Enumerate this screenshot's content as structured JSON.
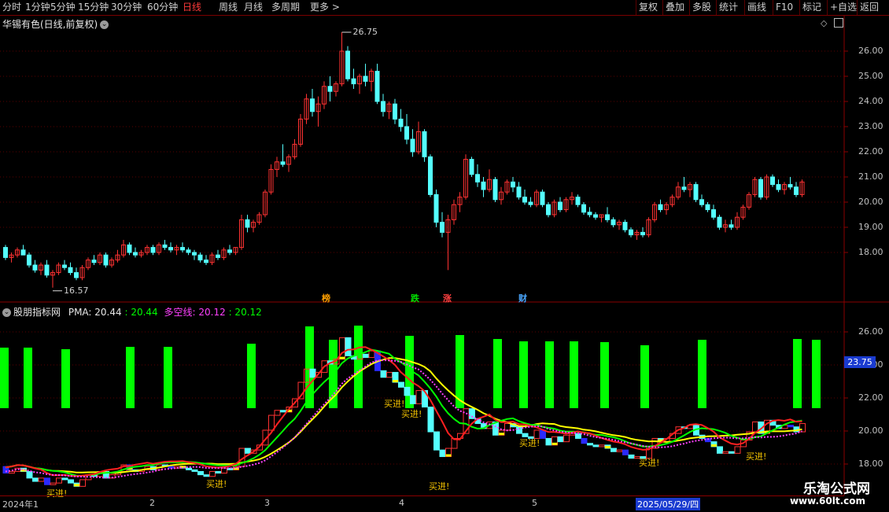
{
  "toolbar": {
    "left": [
      "分时",
      "1分钟",
      "5分钟",
      "15分钟",
      "30分钟",
      "60分钟",
      "日线",
      "周线",
      "月线",
      "多周期",
      "更多 >"
    ],
    "active": "日线",
    "right": [
      "复权",
      "叠加",
      "多股",
      "统计",
      "画线",
      "F10",
      "标记",
      "+自选",
      "返回"
    ]
  },
  "main": {
    "title": "华锡有色(日线,前复权)",
    "y_ticks": [
      "26.00",
      "25.00",
      "24.00",
      "23.00",
      "22.00",
      "21.00",
      "20.00",
      "19.00",
      "18.00"
    ],
    "high_label": "26.75",
    "low_label": "16.57",
    "events": [
      {
        "text": "榜",
        "color": "#ffa000"
      },
      {
        "text": "跌",
        "color": "#00e000"
      },
      {
        "text": "涨",
        "color": "#ff4040"
      },
      {
        "text": "财",
        "color": "#4aa8ff"
      }
    ]
  },
  "indicator": {
    "name": "股朋指标网",
    "pma_label": "PMA: 20.44",
    "pma_value": ": 20.44",
    "dk_label": "多空线: 20.12",
    "dk_value": ": 20.12",
    "y_ticks": [
      "26.00",
      "24.00",
      "22.00",
      "20.00",
      "18.00"
    ],
    "marker": "23.75",
    "notes": [
      "买进!",
      "买进!",
      "买进!",
      "买进!",
      "买进!",
      "买进!",
      "买进!",
      "买进!"
    ]
  },
  "dates": [
    "2024年1",
    "2",
    "3",
    "4",
    "5",
    "2025/05/29/四"
  ],
  "watermark": {
    "line1": "乐淘公式网",
    "line2": "www.60lt.com"
  },
  "colors": {
    "up": "#ff3232",
    "down": "#54ffff",
    "bg": "#000000",
    "grid": "#8a0000",
    "green": "#00ff00",
    "yellow": "#ffff00",
    "magenta": "#ff40ff"
  },
  "chart_data": {
    "type": "candlestick",
    "ylim": [
      17.0,
      27.0
    ],
    "high_marker": 26.75,
    "low_marker": 16.57,
    "ohlc": [
      [
        18.2,
        18.3,
        17.7,
        17.8
      ],
      [
        17.8,
        18.0,
        17.6,
        17.9
      ],
      [
        17.9,
        18.2,
        17.8,
        18.1
      ],
      [
        18.1,
        18.3,
        17.9,
        17.9
      ],
      [
        17.9,
        18.0,
        17.4,
        17.5
      ],
      [
        17.5,
        17.7,
        17.2,
        17.3
      ],
      [
        17.3,
        17.6,
        17.1,
        17.5
      ],
      [
        17.5,
        17.7,
        17.0,
        17.1
      ],
      [
        17.1,
        17.3,
        16.6,
        17.2
      ],
      [
        17.2,
        17.6,
        17.1,
        17.5
      ],
      [
        17.5,
        17.7,
        17.3,
        17.4
      ],
      [
        17.4,
        17.6,
        17.1,
        17.2
      ],
      [
        17.2,
        17.4,
        16.9,
        17.0
      ],
      [
        17.0,
        17.5,
        16.9,
        17.4
      ],
      [
        17.4,
        17.8,
        17.3,
        17.7
      ],
      [
        17.7,
        17.9,
        17.5,
        17.6
      ],
      [
        17.6,
        18.0,
        17.5,
        17.9
      ],
      [
        17.9,
        18.0,
        17.4,
        17.5
      ],
      [
        17.5,
        17.8,
        17.4,
        17.7
      ],
      [
        17.7,
        18.1,
        17.6,
        17.9
      ],
      [
        17.9,
        18.5,
        17.8,
        18.3
      ],
      [
        18.3,
        18.4,
        17.9,
        18.0
      ],
      [
        18.0,
        18.2,
        17.8,
        17.9
      ],
      [
        17.9,
        18.1,
        17.8,
        18.0
      ],
      [
        18.0,
        18.3,
        17.9,
        18.2
      ],
      [
        18.2,
        18.3,
        17.9,
        18.0
      ],
      [
        18.0,
        18.4,
        17.9,
        18.3
      ],
      [
        18.3,
        18.5,
        18.1,
        18.2
      ],
      [
        18.2,
        18.4,
        18.0,
        18.1
      ],
      [
        18.1,
        18.3,
        17.9,
        18.2
      ],
      [
        18.2,
        18.4,
        18.0,
        18.1
      ],
      [
        18.1,
        18.2,
        17.9,
        18.0
      ],
      [
        18.0,
        18.1,
        17.7,
        17.9
      ],
      [
        17.9,
        18.0,
        17.6,
        17.7
      ],
      [
        17.7,
        17.9,
        17.5,
        17.6
      ],
      [
        17.6,
        18.0,
        17.5,
        17.9
      ],
      [
        17.9,
        18.1,
        17.7,
        17.8
      ],
      [
        17.8,
        18.2,
        17.7,
        18.1
      ],
      [
        18.1,
        18.3,
        17.9,
        18.0
      ],
      [
        18.0,
        18.2,
        17.9,
        18.2
      ],
      [
        18.2,
        19.5,
        18.1,
        19.3
      ],
      [
        19.3,
        19.5,
        18.8,
        19.0
      ],
      [
        19.0,
        19.3,
        18.8,
        19.2
      ],
      [
        19.2,
        19.6,
        19.1,
        19.5
      ],
      [
        19.5,
        20.5,
        19.4,
        20.4
      ],
      [
        20.4,
        21.5,
        20.3,
        21.3
      ],
      [
        21.3,
        21.8,
        21.0,
        21.6
      ],
      [
        21.6,
        22.3,
        21.4,
        21.5
      ],
      [
        21.5,
        21.9,
        21.2,
        21.8
      ],
      [
        21.8,
        22.5,
        21.7,
        22.3
      ],
      [
        22.3,
        23.5,
        22.2,
        23.3
      ],
      [
        23.3,
        24.3,
        23.1,
        24.1
      ],
      [
        24.1,
        24.5,
        23.4,
        23.6
      ],
      [
        23.6,
        24.2,
        23.0,
        23.9
      ],
      [
        23.9,
        24.8,
        23.7,
        24.6
      ],
      [
        24.6,
        25.0,
        24.0,
        24.4
      ],
      [
        24.4,
        24.8,
        24.2,
        24.7
      ],
      [
        24.7,
        26.75,
        24.6,
        26.0
      ],
      [
        26.0,
        26.2,
        24.8,
        24.9
      ],
      [
        24.9,
        25.3,
        24.5,
        24.7
      ],
      [
        24.7,
        25.1,
        24.3,
        25.0
      ],
      [
        25.0,
        25.5,
        24.6,
        24.8
      ],
      [
        24.8,
        25.3,
        24.4,
        25.2
      ],
      [
        25.2,
        25.5,
        23.9,
        24.0
      ],
      [
        24.0,
        24.3,
        23.4,
        23.6
      ],
      [
        23.6,
        24.0,
        23.3,
        23.9
      ],
      [
        23.9,
        24.1,
        23.1,
        23.3
      ],
      [
        23.3,
        23.7,
        22.8,
        23.0
      ],
      [
        23.0,
        23.5,
        22.3,
        22.5
      ],
      [
        22.5,
        22.9,
        21.8,
        22.0
      ],
      [
        22.0,
        23.2,
        21.9,
        22.8
      ],
      [
        22.8,
        22.9,
        21.6,
        21.8
      ],
      [
        21.8,
        21.9,
        20.2,
        20.3
      ],
      [
        20.3,
        20.5,
        19.0,
        19.2
      ],
      [
        19.2,
        19.6,
        18.6,
        18.8
      ],
      [
        18.8,
        19.5,
        17.3,
        19.3
      ],
      [
        19.3,
        20.1,
        19.1,
        19.9
      ],
      [
        19.9,
        20.4,
        19.6,
        20.2
      ],
      [
        20.2,
        21.9,
        20.1,
        21.7
      ],
      [
        21.7,
        21.8,
        21.0,
        21.1
      ],
      [
        21.1,
        21.5,
        20.6,
        20.8
      ],
      [
        20.8,
        21.0,
        20.2,
        20.5
      ],
      [
        20.5,
        21.3,
        20.4,
        20.9
      ],
      [
        20.9,
        21.0,
        20.0,
        20.1
      ],
      [
        20.1,
        20.6,
        19.9,
        20.4
      ],
      [
        20.4,
        20.9,
        20.3,
        20.8
      ],
      [
        20.8,
        21.0,
        20.4,
        20.6
      ],
      [
        20.6,
        20.8,
        20.1,
        20.2
      ],
      [
        20.2,
        20.5,
        19.9,
        20.0
      ],
      [
        20.0,
        20.2,
        19.8,
        19.9
      ],
      [
        19.9,
        20.5,
        19.8,
        20.4
      ],
      [
        20.4,
        20.5,
        19.8,
        19.9
      ],
      [
        19.9,
        20.0,
        19.4,
        19.5
      ],
      [
        19.5,
        20.1,
        19.4,
        20.0
      ],
      [
        20.0,
        20.2,
        19.6,
        19.7
      ],
      [
        19.7,
        20.2,
        19.6,
        20.1
      ],
      [
        20.1,
        20.4,
        19.9,
        20.2
      ],
      [
        20.2,
        20.3,
        19.8,
        19.9
      ],
      [
        19.9,
        20.0,
        19.5,
        19.6
      ],
      [
        19.6,
        19.8,
        19.4,
        19.5
      ],
      [
        19.5,
        19.6,
        19.3,
        19.4
      ],
      [
        19.4,
        19.5,
        19.2,
        19.5
      ],
      [
        19.5,
        19.8,
        19.2,
        19.3
      ],
      [
        19.3,
        19.4,
        19.0,
        19.1
      ],
      [
        19.1,
        19.3,
        18.9,
        19.2
      ],
      [
        19.2,
        19.3,
        18.8,
        18.9
      ],
      [
        18.9,
        19.0,
        18.6,
        18.7
      ],
      [
        18.7,
        18.9,
        18.5,
        18.8
      ],
      [
        18.8,
        19.0,
        18.6,
        18.7
      ],
      [
        18.7,
        19.4,
        18.6,
        19.3
      ],
      [
        19.3,
        20.0,
        19.2,
        19.9
      ],
      [
        19.9,
        20.1,
        19.6,
        19.7
      ],
      [
        19.7,
        20.0,
        19.5,
        19.9
      ],
      [
        19.9,
        20.3,
        19.8,
        20.2
      ],
      [
        20.2,
        20.8,
        20.1,
        20.6
      ],
      [
        20.6,
        21.0,
        20.4,
        20.5
      ],
      [
        20.5,
        20.8,
        20.2,
        20.7
      ],
      [
        20.7,
        20.8,
        20.0,
        20.1
      ],
      [
        20.1,
        20.3,
        19.8,
        19.9
      ],
      [
        19.9,
        20.0,
        19.6,
        19.7
      ],
      [
        19.7,
        19.9,
        19.3,
        19.4
      ],
      [
        19.4,
        19.5,
        18.9,
        19.0
      ],
      [
        19.0,
        19.3,
        18.8,
        19.1
      ],
      [
        19.1,
        19.3,
        18.9,
        19.0
      ],
      [
        19.0,
        19.6,
        18.9,
        19.4
      ],
      [
        19.4,
        19.9,
        19.3,
        19.8
      ],
      [
        19.8,
        20.4,
        19.7,
        20.3
      ],
      [
        20.3,
        21.0,
        20.2,
        20.9
      ],
      [
        20.9,
        21.0,
        20.1,
        20.2
      ],
      [
        20.2,
        21.1,
        20.1,
        21.0
      ],
      [
        21.0,
        21.1,
        20.6,
        20.7
      ],
      [
        20.7,
        20.9,
        20.4,
        20.5
      ],
      [
        20.5,
        20.8,
        20.3,
        20.7
      ],
      [
        20.7,
        21.0,
        20.5,
        20.6
      ],
      [
        20.6,
        20.8,
        20.2,
        20.3
      ],
      [
        20.3,
        20.9,
        20.2,
        20.8
      ]
    ]
  }
}
